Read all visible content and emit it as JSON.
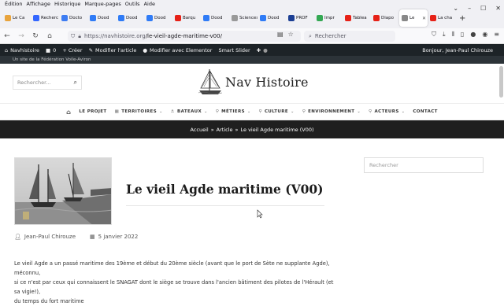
{
  "browser": {
    "menu": [
      "Édition",
      "Affichage",
      "Historique",
      "Marque-pages",
      "Outils",
      "Aide"
    ],
    "tabs": [
      {
        "label": "Le Ca",
        "color": "#e8a33c"
      },
      {
        "label": "Recherc",
        "color": "#3366ff"
      },
      {
        "label": "Docto",
        "color": "#3d7cf2"
      },
      {
        "label": "Dood",
        "color": "#2f7bf6"
      },
      {
        "label": "Dood",
        "color": "#2f7bf6"
      },
      {
        "label": "Dood",
        "color": "#2f7bf6"
      },
      {
        "label": "Barqu",
        "color": "#e62117"
      },
      {
        "label": "Dood",
        "color": "#2f7bf6"
      },
      {
        "label": "Sciences",
        "color": "#999999"
      },
      {
        "label": "Dood",
        "color": "#2f7bf6"
      },
      {
        "label": "PROF",
        "color": "#1c3f94"
      },
      {
        "label": "Impr",
        "color": "#34a853"
      },
      {
        "label": "Tablea",
        "color": "#e62117"
      },
      {
        "label": "Diapo",
        "color": "#e62117"
      },
      {
        "label": "Le",
        "color": "#888888",
        "active": true
      },
      {
        "label": "La cha",
        "color": "#e62117"
      }
    ],
    "url_host": "https://navhistoire.org",
    "url_path": "/le-vieil-agde-maritime-v00/",
    "search_placeholder": "Rechercher"
  },
  "adminbar": {
    "site": "Navhistoire",
    "comments": "0",
    "new": "+ Créer",
    "edit": "Modifier l'article",
    "elementor": "Modifier avec Elementor",
    "smart_slider": "Smart Slider",
    "greeting": "Bonjour, Jean-Paul Chirouze",
    "sub": "Un site de la Fédération Voile-Aviron"
  },
  "site": {
    "search_placeholder": "Rechercher...",
    "logo_text": "Nav Histoire",
    "nav": [
      {
        "label": "LE PROJET",
        "dropdown": false
      },
      {
        "label": "TERRITOIRES",
        "dropdown": true
      },
      {
        "label": "BATEAUX",
        "dropdown": true
      },
      {
        "label": "MÉTIERS",
        "dropdown": true
      },
      {
        "label": "CULTURE",
        "dropdown": true
      },
      {
        "label": "ENVIRONNEMENT",
        "dropdown": true
      },
      {
        "label": "ACTEURS",
        "dropdown": true
      },
      {
        "label": "CONTACT",
        "dropdown": false
      }
    ],
    "breadcrumb": [
      "Accueil",
      "Article",
      "Le vieil Agde maritime (V00)"
    ],
    "breadcrumb_sep": "»"
  },
  "article": {
    "title": "Le vieil Agde maritime (V00)",
    "author": "Jean-Paul Chirouze",
    "date": "5 janvier 2022",
    "body_line1": "Le vieil Agde a un passé maritime des 19ème et début du 20ème siècle (avant que le port de Sète ne supplante Agde), méconnu,",
    "body_line2": "si ce n'est par ceux qui connaissent le SNAGAT dont le siège se trouve dans l'ancien bâtiment des pilotes de l'Hérault (et sa vigie!),",
    "body_line3": "du temps du fort maritime",
    "sidebar_search_placeholder": "Rechercher"
  }
}
